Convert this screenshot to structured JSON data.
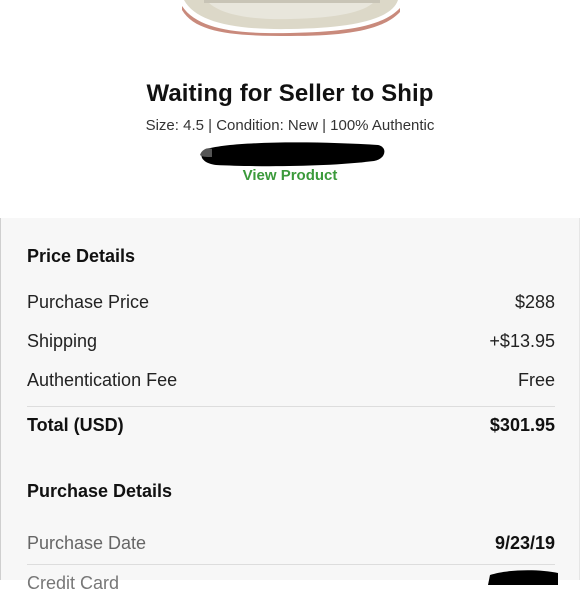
{
  "product": {
    "status_title": "Waiting for Seller to Ship",
    "meta": "Size: 4.5 | Condition: New | 100% Authentic",
    "view_product_label": "View Product"
  },
  "price_details": {
    "title": "Price Details",
    "rows": [
      {
        "label": "Purchase Price",
        "value": "$288"
      },
      {
        "label": "Shipping",
        "value": "+$13.95"
      },
      {
        "label": "Authentication Fee",
        "value": "Free"
      }
    ],
    "total": {
      "label": "Total (USD)",
      "value": "$301.95"
    }
  },
  "purchase_details": {
    "title": "Purchase Details",
    "rows": [
      {
        "label": "Purchase Date",
        "value": "9/23/19"
      }
    ],
    "partial_row_label": "Credit Card"
  },
  "colors": {
    "accent_green": "#3b9a3b",
    "panel_bg": "#f7f7f7",
    "divider": "#dddddd"
  }
}
